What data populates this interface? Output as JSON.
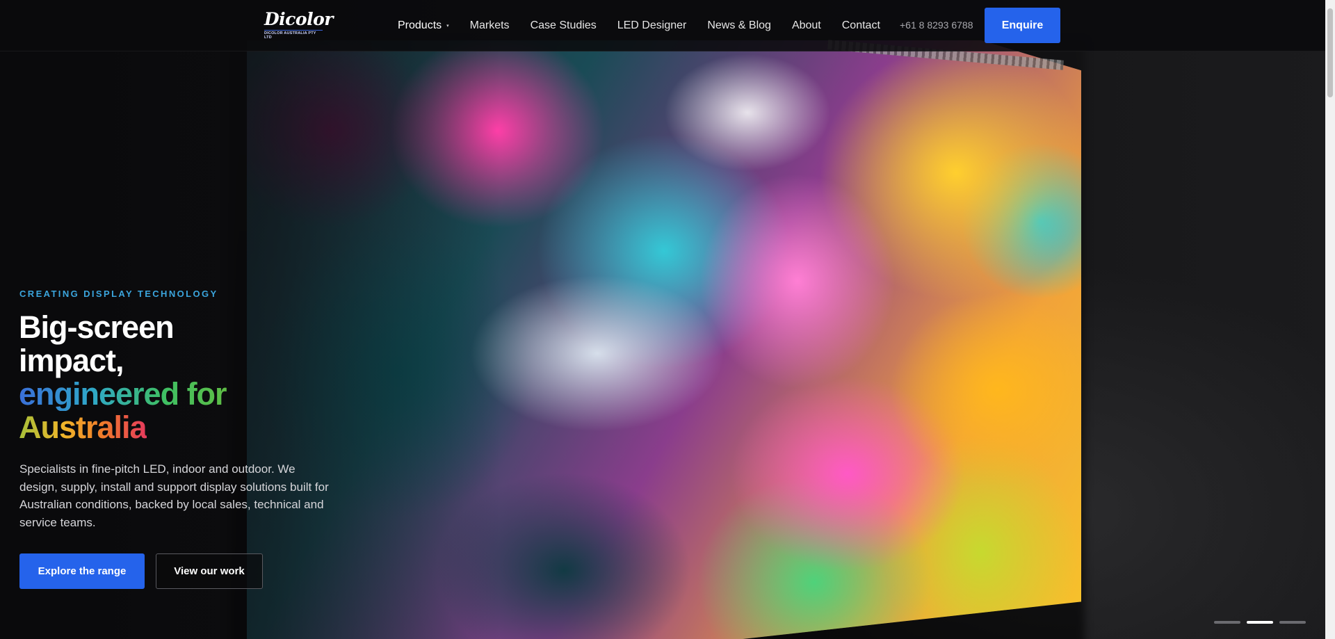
{
  "header": {
    "logo": {
      "wordmark": "Dicolor",
      "subtitle": "DICOLOR AUSTRALIA PTY LTD"
    },
    "nav": [
      {
        "label": "Products",
        "has_dropdown": true
      },
      {
        "label": "Markets",
        "has_dropdown": false
      },
      {
        "label": "Case Studies",
        "has_dropdown": false
      },
      {
        "label": "LED Designer",
        "has_dropdown": false
      },
      {
        "label": "News & Blog",
        "has_dropdown": false
      },
      {
        "label": "About",
        "has_dropdown": false
      },
      {
        "label": "Contact",
        "has_dropdown": false
      }
    ],
    "dropdown_caret": "▾",
    "phone": "+61 8 8293 6788",
    "cta": "Enquire"
  },
  "hero": {
    "eyebrow": "CREATING DISPLAY TECHNOLOGY",
    "headline": {
      "line1": "Big-screen",
      "line2": "impact,",
      "line3": "engineered for",
      "line4": "Australia"
    },
    "body": "Specialists in fine-pitch LED, indoor and outdoor. We design, supply, install and support display solutions built for Australian conditions, backed by local sales, technical and service teams.",
    "primary_button": "Explore the range",
    "secondary_button": "View our work"
  },
  "slider": {
    "count": 3,
    "active_index": 1
  },
  "colors": {
    "accent_blue": "#2563eb",
    "eyebrow_blue": "#3ba5dd",
    "background": "#0d0d0f"
  }
}
